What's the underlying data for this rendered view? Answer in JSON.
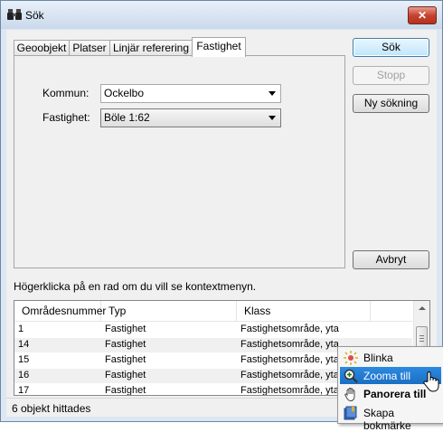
{
  "window": {
    "title": "Sök",
    "close_label": "✕"
  },
  "tabs": [
    {
      "label": "Geoobjekt",
      "active": false
    },
    {
      "label": "Platser",
      "active": false
    },
    {
      "label": "Linjär referering",
      "active": false
    },
    {
      "label": "Fastighet",
      "active": true
    }
  ],
  "form": {
    "kommun_label": "Kommun:",
    "kommun_value": "Ockelbo",
    "fastighet_label": "Fastighet:",
    "fastighet_value": "Böle 1:62"
  },
  "buttons": {
    "search": "Sök",
    "stop": "Stopp",
    "new_search": "Ny sökning",
    "cancel": "Avbryt"
  },
  "hint": "Högerklicka på en rad om du vill se kontextmenyn.",
  "table": {
    "columns": [
      "Områdesnummer",
      "Typ",
      "Klass"
    ],
    "rows": [
      [
        "1",
        "Fastighet",
        "Fastighetsområde, yta"
      ],
      [
        "14",
        "Fastighet",
        "Fastighetsområde, yta"
      ],
      [
        "15",
        "Fastighet",
        "Fastighetsområde, yta"
      ],
      [
        "16",
        "Fastighet",
        "Fastighetsområde, yta"
      ],
      [
        "17",
        "Fastighet",
        "Fastighetsområde, yta"
      ]
    ]
  },
  "status": "6 objekt hittades",
  "context_menu": {
    "items": [
      {
        "label": "Blinka",
        "icon": "blink-icon"
      },
      {
        "label": "Zooma till",
        "icon": "zoom-in-icon",
        "highlighted": true
      },
      {
        "label": "Panorera till",
        "icon": "pan-hand-icon",
        "bold": true
      },
      {
        "label": "Skapa bokmärke",
        "icon": "bookmark-icon"
      }
    ]
  }
}
